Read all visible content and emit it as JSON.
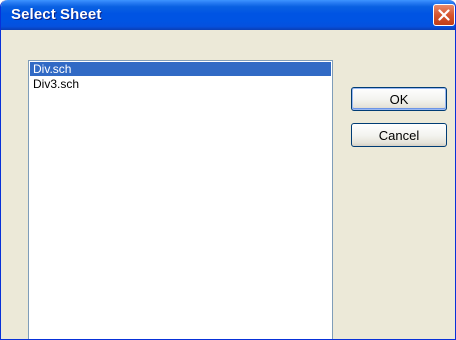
{
  "window": {
    "title": "Select Sheet"
  },
  "list": {
    "items": [
      "Div.sch",
      "Div3.sch"
    ],
    "selected_index": 0
  },
  "buttons": {
    "ok_label": "OK",
    "cancel_label": "Cancel"
  },
  "icons": {
    "close": "close-icon"
  },
  "colors": {
    "titlebar": "#0054e3",
    "selection": "#316ac5",
    "dialog_bg": "#ece9d8",
    "close_button": "#d6552e"
  }
}
